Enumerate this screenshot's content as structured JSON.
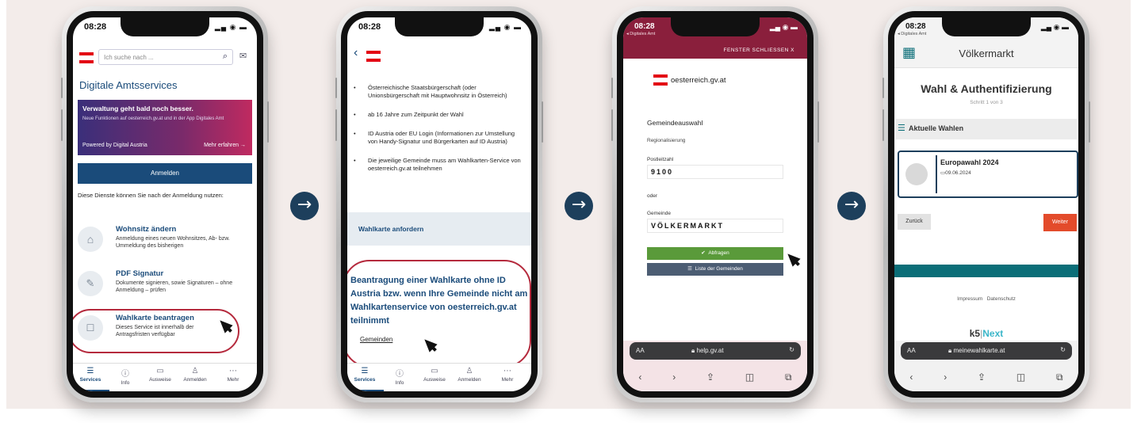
{
  "arrow_glyph": "→",
  "status": {
    "time": "08:28",
    "icons": "▂▄ ◉ ▬"
  },
  "phone1": {
    "search_placeholder": "Ich suche nach ...",
    "title": "Digitale Amtsservices",
    "banner_title": "Verwaltung geht bald noch besser.",
    "banner_text": "Neue Funktionen auf oesterreich.gv.at und in der App Digitales Amt",
    "banner_powered": "Powered by Digital Austria",
    "banner_more": "Mehr erfahren",
    "login_button": "Anmelden",
    "login_note": "Diese Dienste können Sie nach der Anmeldung nutzen:",
    "services": [
      {
        "title": "Wohnsitz ändern",
        "desc": "Anmeldung eines neuen Wohnsitzes, Ab- bzw. Ummeldung des bisherigen",
        "icon": "house-icon"
      },
      {
        "title": "PDF Signatur",
        "desc": "Dokumente signieren, sowie Signaturen – ohne Anmeldung – prüfen",
        "icon": "pen-icon"
      },
      {
        "title": "Wahlkarte beantragen",
        "desc": "Dieses Service ist innerhalb der Antragsfristen verfügbar",
        "icon": "ballot-icon"
      }
    ],
    "nav": [
      "Services",
      "Info",
      "Ausweise",
      "Anmelden",
      "Mehr"
    ]
  },
  "phone2": {
    "bullets": [
      "Österreichische Staatsbürgerschaft (oder Unionsbürgerschaft mit Hauptwohnsitz in Österreich)",
      "ab 16 Jahre zum Zeitpunkt der Wahl",
      "ID Austria oder EU Login (Informationen zur Umstellung von Handy-Signatur und Bürgerkarten auf ID Austria)",
      "Die jeweilige Gemeinde muss am Wahlkarten-Service von oesterreich.gv.at teilnehmen"
    ],
    "request_box": "Wahlkarte anfordern",
    "highlight": "Beantragung einer Wahlkarte ohne ID Austria bzw. wenn Ihre Gemeinde nicht am Wahlkartenservice von oesterreich.gv.at teilnimmt",
    "link": "Gemeinden",
    "nav": [
      "Services",
      "Info",
      "Ausweise",
      "Anmelden",
      "Mehr"
    ]
  },
  "phone3": {
    "back_app": "◂ Digitales Amt",
    "close_window": "FENSTER SCHLIESSEN X",
    "logo_text": "oesterreich.gv.at",
    "section": "Gemeindeauswahl",
    "subsection": "Regionalisierung",
    "postal_label": "Postleitzahl",
    "postal_value": "9100",
    "or": "oder",
    "municipality_label": "Gemeinde",
    "municipality_value": "VÖLKERMARKT",
    "submit": "Abfragen",
    "list_button": "Liste der Gemeinden",
    "url": "help.gv.at",
    "aa": "AA"
  },
  "phone4": {
    "back_app": "◂ Digitales Amt",
    "header": "Völkermarkt",
    "title": "Wahl & Authentifizierung",
    "step": "Schritt 1 von 3",
    "section": "Aktuelle Wahlen",
    "election_name": "Europawahl 2024",
    "election_date": "09.06.2024",
    "back": "Zurück",
    "next": "Weiter",
    "links": [
      "Impressum",
      "Datenschutz"
    ],
    "brand_a": "k5",
    "brand_b": "Next",
    "url": "meinewahlkarte.at",
    "aa": "AA"
  },
  "colors": {
    "navy": "#1d3f5c",
    "crimson": "#8a1f3c",
    "green": "#5a9a3a",
    "red": "#e34b2b",
    "teal": "#0b6e78"
  }
}
